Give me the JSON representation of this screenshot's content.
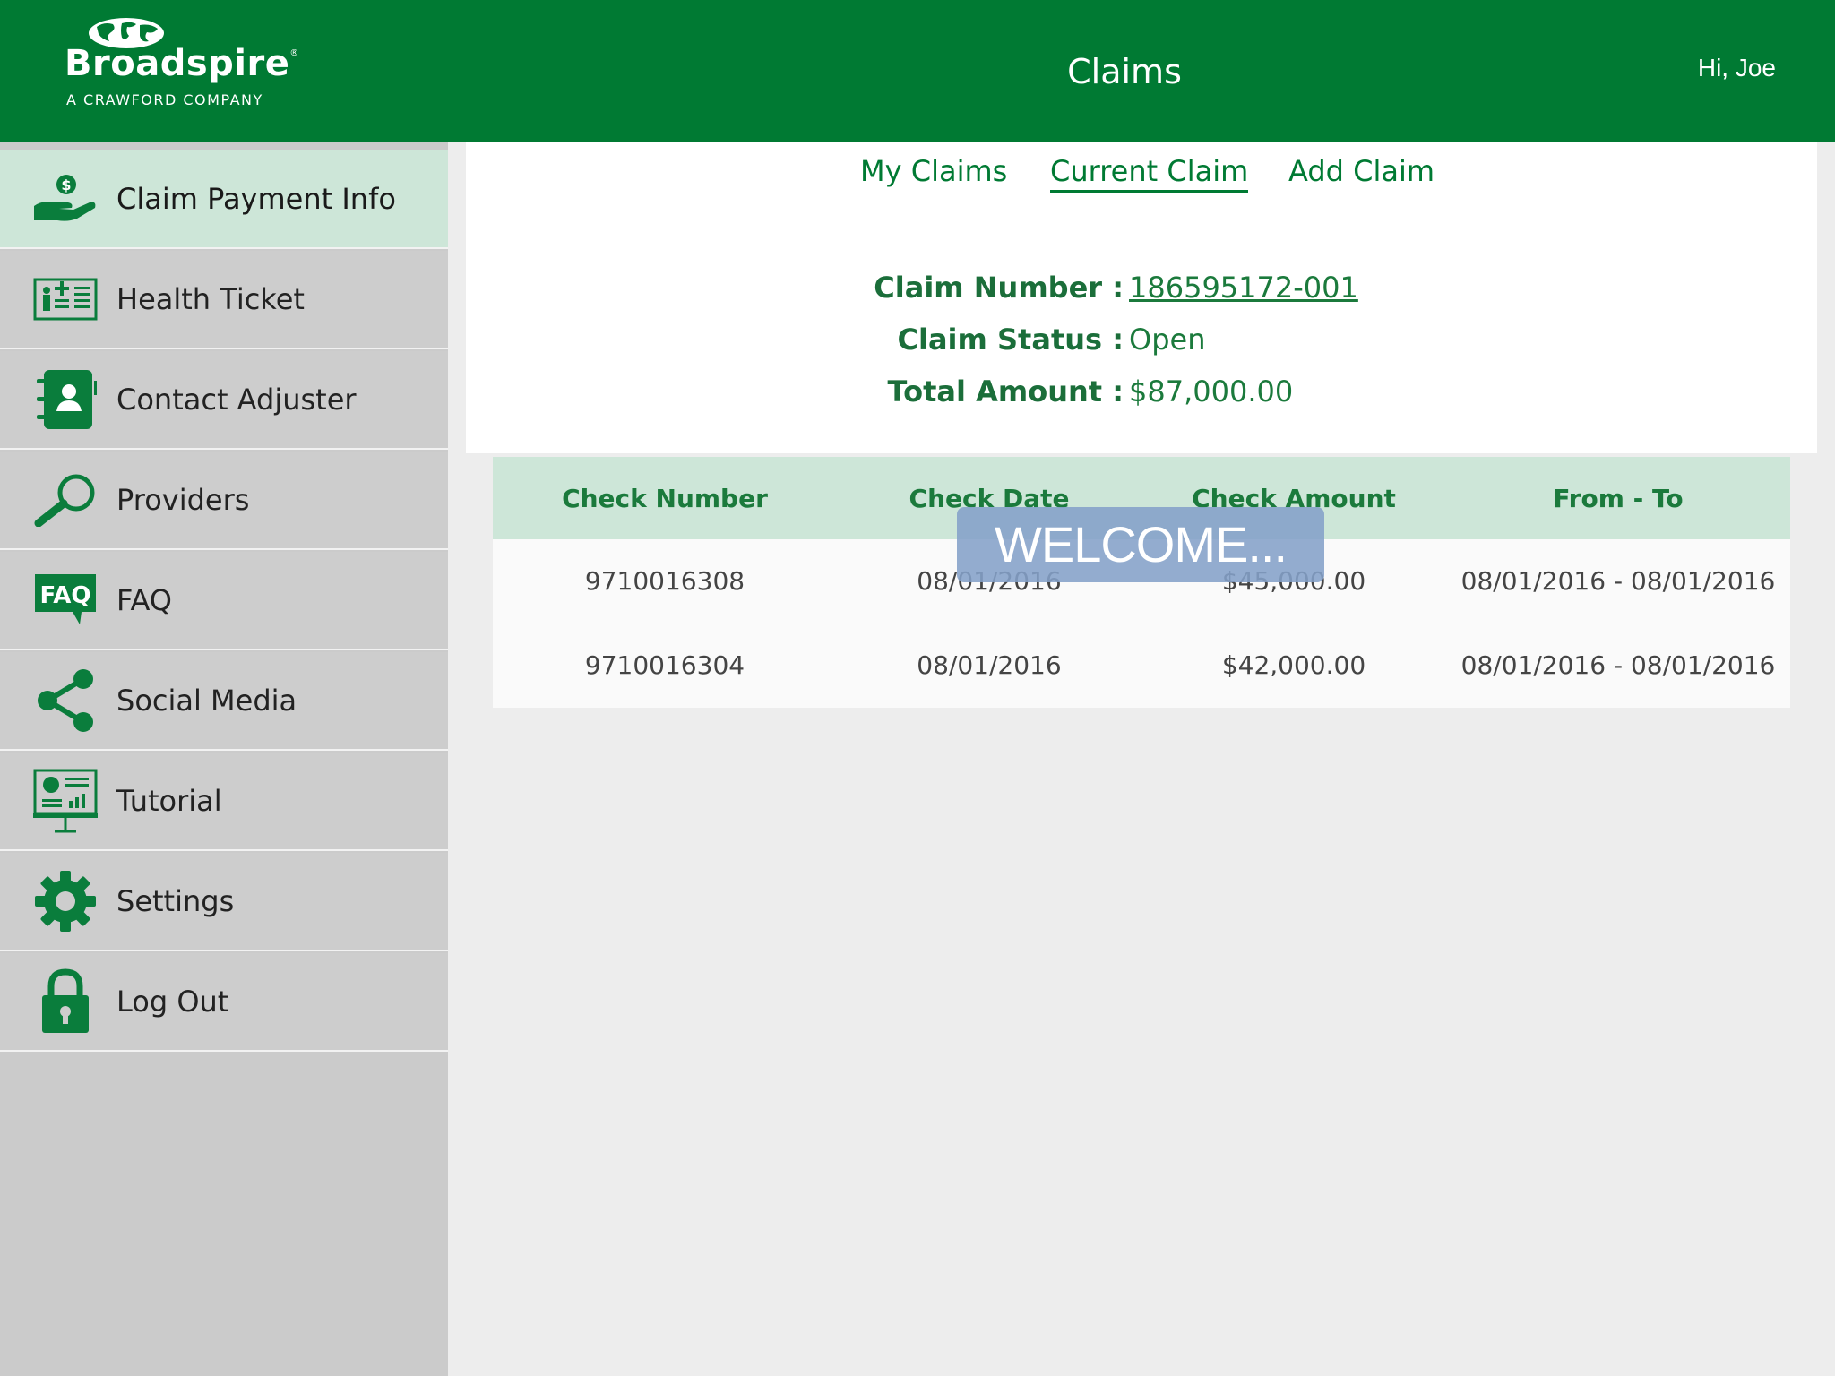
{
  "header": {
    "brand": "Broadspire",
    "registered_mark": "®",
    "tagline": "A CRAWFORD COMPANY",
    "title": "Claims",
    "greeting": "Hi, Joe"
  },
  "sidebar": {
    "items": [
      {
        "label": "Claim Payment Info",
        "icon": "hand-dollar-icon",
        "active": true
      },
      {
        "label": "Health Ticket",
        "icon": "health-card-icon"
      },
      {
        "label": "Contact Adjuster",
        "icon": "contact-book-icon"
      },
      {
        "label": "Providers",
        "icon": "magnifier-icon"
      },
      {
        "label": "FAQ",
        "icon": "faq-icon"
      },
      {
        "label": "Social Media",
        "icon": "share-icon"
      },
      {
        "label": "Tutorial",
        "icon": "presentation-icon"
      },
      {
        "label": "Settings",
        "icon": "gear-icon"
      },
      {
        "label": "Log Out",
        "icon": "lock-icon"
      }
    ]
  },
  "tabs": [
    {
      "label": "My Claims"
    },
    {
      "label": "Current Claim",
      "active": true
    },
    {
      "label": "Add Claim"
    }
  ],
  "claim": {
    "number_label": "Claim Number :",
    "number": "186595172-001",
    "status_label": "Claim Status :",
    "status": "Open",
    "total_label": "Total Amount :",
    "total": "$87,000.00"
  },
  "payments": {
    "columns": [
      "Check Number",
      "Check Date",
      "Check Amount",
      "From - To"
    ],
    "rows": [
      [
        "9710016308",
        "08/01/2016",
        "$45,000.00",
        "08/01/2016 - 08/01/2016"
      ],
      [
        "9710016304",
        "08/01/2016",
        "$42,000.00",
        "08/01/2016 - 08/01/2016"
      ]
    ]
  },
  "overlay": {
    "text": "WELCOME..."
  },
  "colors": {
    "brand_green": "#007a33",
    "active_bg": "#cde6d8",
    "sidebar_bg": "#cdcdcd",
    "text_green": "#1b7a3c"
  }
}
